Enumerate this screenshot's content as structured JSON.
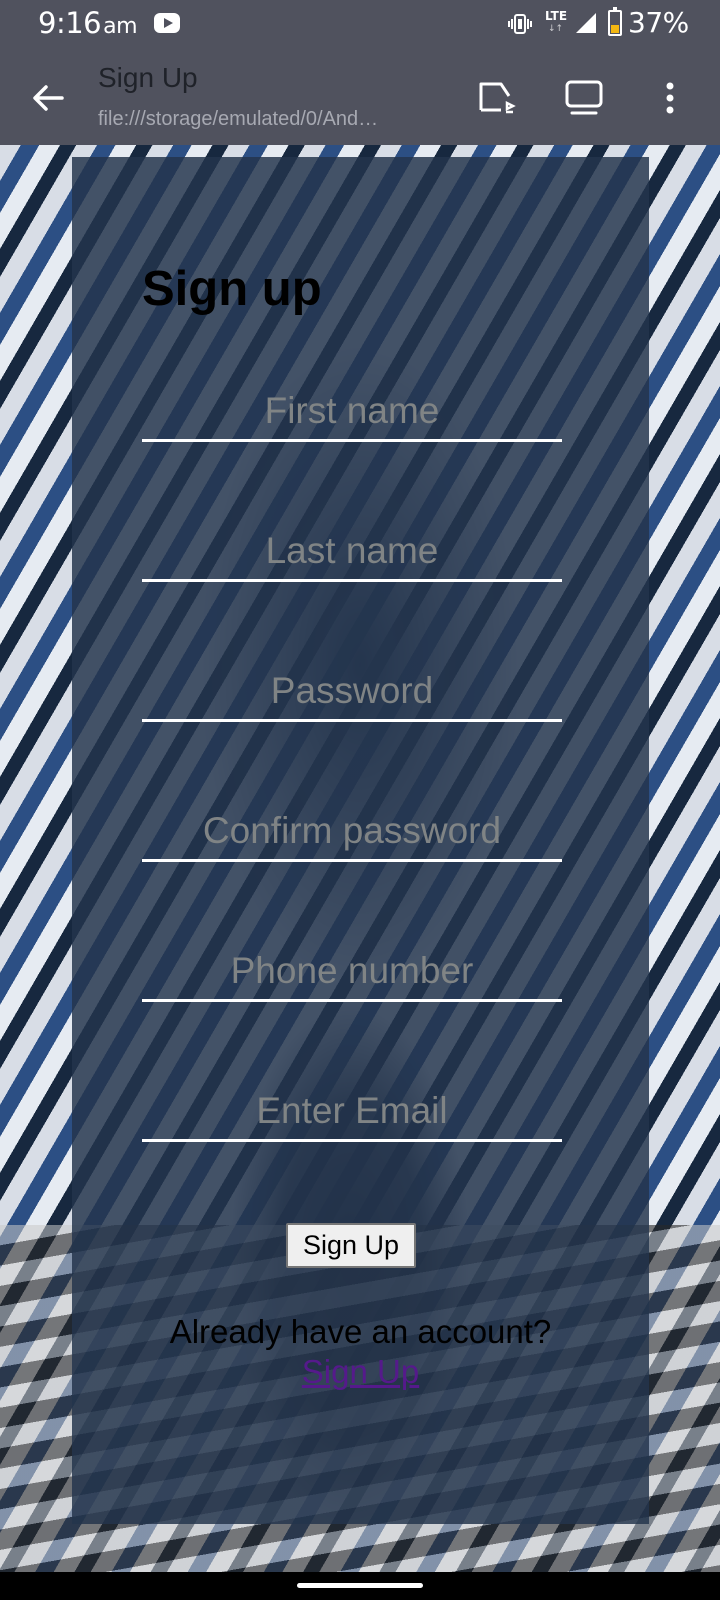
{
  "status_bar": {
    "time": "9:16",
    "ampm": "am",
    "network": "LTE",
    "battery": "37%",
    "battery_level": 0.37,
    "icons": [
      "youtube-icon",
      "vibrate-icon",
      "signal-icon",
      "battery-icon"
    ]
  },
  "app_bar": {
    "title": "Sign Up",
    "url": "file:///storage/emulated/0/And…",
    "icons": [
      "back-arrow-icon",
      "open-external-icon",
      "tabs-icon",
      "more-vert-icon"
    ]
  },
  "form": {
    "heading": "Sign up",
    "fields": {
      "first_name": {
        "placeholder": "First name",
        "value": ""
      },
      "last_name": {
        "placeholder": "Last name",
        "value": ""
      },
      "password": {
        "placeholder": "Password",
        "value": ""
      },
      "confirm_password": {
        "placeholder": "Confirm password",
        "value": ""
      },
      "phone": {
        "placeholder": "Phone number",
        "value": ""
      },
      "email": {
        "placeholder": "Enter Email",
        "value": ""
      }
    },
    "submit_label": "Sign Up",
    "have_account_text": "Already have an account?",
    "link_text": "Sign Up"
  },
  "colors": {
    "bar": "#50525e",
    "card": "#24344c",
    "link": "#551a8b",
    "battery": "#f3b712"
  }
}
